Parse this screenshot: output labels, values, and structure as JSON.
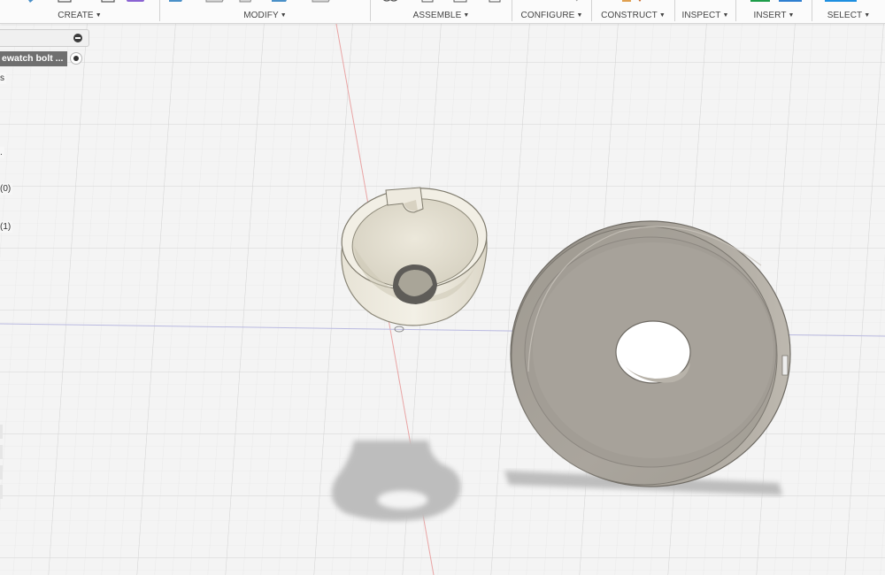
{
  "toolbar": {
    "groups": [
      {
        "label": "CREATE"
      },
      {
        "label": "MODIFY"
      },
      {
        "label": "ASSEMBLE"
      },
      {
        "label": "CONFIGURE"
      },
      {
        "label": "CONSTRUCT"
      },
      {
        "label": "INSPECT"
      },
      {
        "label": "INSERT"
      },
      {
        "label": "SELECT"
      }
    ],
    "caret": "▼"
  },
  "browser": {
    "component_name": "ewatch bolt ...",
    "fragments": [
      "s",
      ".",
      "(0)",
      "(1)"
    ]
  },
  "colors": {
    "background": "#f4f4f4",
    "grid": "#dcdcdc",
    "x_axis": "#e9a4a4",
    "y_axis": "#b9b9e0",
    "part_body": "#eeebe0",
    "disc_body": "#a8a49d",
    "shadow": "#bebebe",
    "select_accent": "#1e8fe0"
  }
}
